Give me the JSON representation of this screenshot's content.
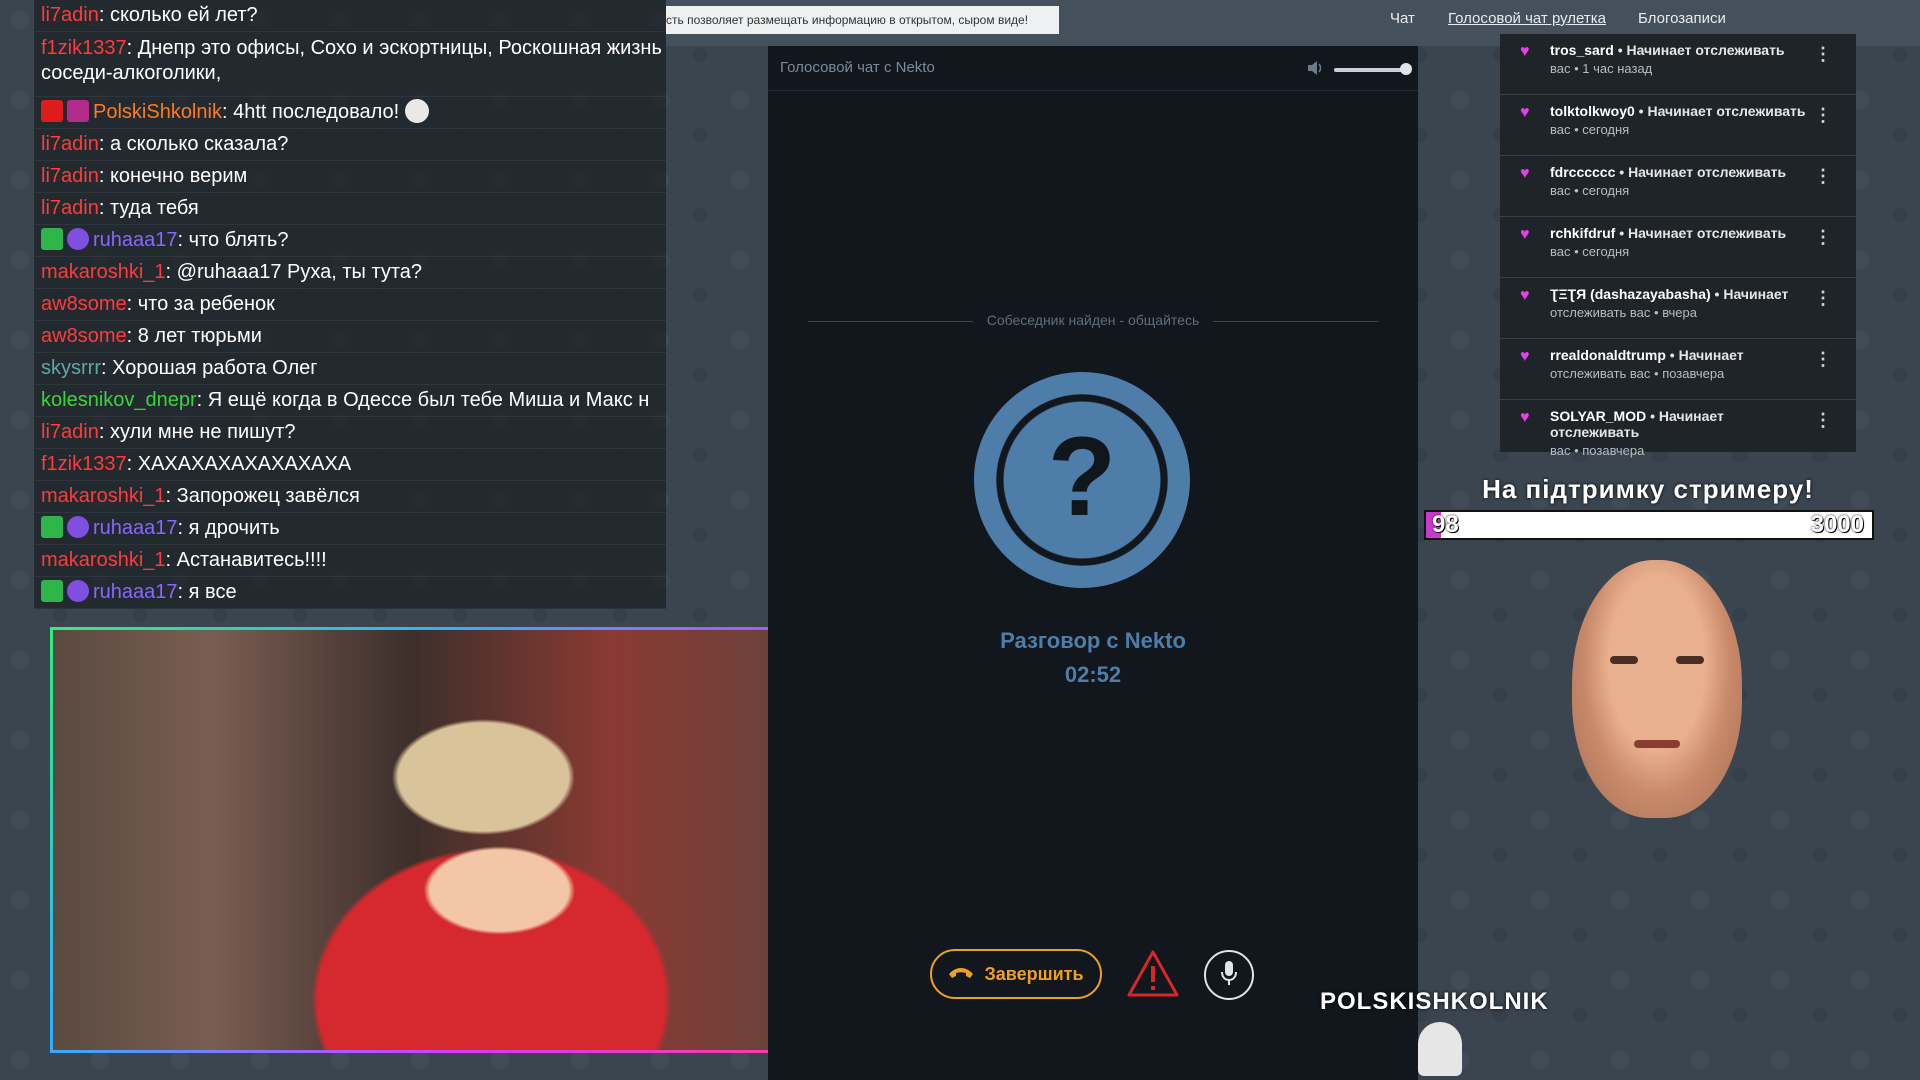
{
  "nav": {
    "notice": "сть позволяет размещать информацию в открытом, сыром виде!",
    "links": [
      "Чат",
      "Голосовой чат рулетка",
      "Блогозаписи"
    ]
  },
  "chat": [
    {
      "user": "li7adin",
      "color": "#ff3b3b",
      "text": "сколько ей лет?"
    },
    {
      "user": "f1zik1337",
      "color": "#ff3b3b",
      "text": "Днепр это офисы, Сохо и эскортницы, Роскошная жизнь соседи-алкоголики,",
      "tall": true
    },
    {
      "user": "PolskiShkolnik",
      "color": "#ff7a1a",
      "text": "4htt последовало!",
      "badges": [
        "red",
        "gift"
      ],
      "emote": true
    },
    {
      "user": "li7adin",
      "color": "#ff3b3b",
      "text": "а сколько сказала?"
    },
    {
      "user": "li7adin",
      "color": "#ff3b3b",
      "text": "конечно верим"
    },
    {
      "user": "li7adin",
      "color": "#ff3b3b",
      "text": "туда тебя"
    },
    {
      "user": "ruhaaa17",
      "color": "#8a66ff",
      "text": "что блять?",
      "badges": [
        "green",
        "purple"
      ]
    },
    {
      "user": "makaroshki_1",
      "color": "#ff3b3b",
      "text": "@ruhaaa17 Руха, ты тута?"
    },
    {
      "user": "aw8some",
      "color": "#ff3b3b",
      "text": "что за ребенок"
    },
    {
      "user": "aw8some",
      "color": "#ff3b3b",
      "text": "8 лет тюрьми"
    },
    {
      "user": "skysrrr",
      "color": "#5fa7a7",
      "text": "Хорошая работа Олег"
    },
    {
      "user": "kolesnikov_dnepr",
      "color": "#36d63a",
      "text": "Я ещё когда в Одессе был тебе Миша и Макс н"
    },
    {
      "user": "li7adin",
      "color": "#ff3b3b",
      "text": "хули мне не пишут?"
    },
    {
      "user": "f1zik1337",
      "color": "#ff3b3b",
      "text": "ХАХАХАХАХАХАХАХА"
    },
    {
      "user": "makaroshki_1",
      "color": "#ff3b3b",
      "text": "Запорожец завёлся"
    },
    {
      "user": "ruhaaa17",
      "color": "#8a66ff",
      "text": "я дрочить",
      "badges": [
        "green",
        "purple"
      ]
    },
    {
      "user": "makaroshki_1",
      "color": "#ff3b3b",
      "text": "Астанавитесь!!!!"
    },
    {
      "user": "ruhaaa17",
      "color": "#8a66ff",
      "text": "я все",
      "badges": [
        "green",
        "purple"
      ]
    }
  ],
  "voice": {
    "title": "Голосовой чат с Nekto",
    "status": "Собеседник найден - общайтесь",
    "conversation": "Разговор с Nekto",
    "timer": "02:52",
    "end_label": "Завершить"
  },
  "follows": [
    {
      "name": "tros_sard",
      "line1_rest": " • Начинает отслеживать",
      "line2": "вас • 1 час назад"
    },
    {
      "name": "tolktolkwoy0",
      "line1_rest": " • Начинает отслеживать",
      "line2": "вас • сегодня"
    },
    {
      "name": "fdrcccccc",
      "line1_rest": " • Начинает отслеживать",
      "line2": "вас • сегодня"
    },
    {
      "name": "rchkifdruf",
      "line1_rest": " • Начинает отслеживать",
      "line2": "вас • сегодня"
    },
    {
      "name": "ƮΞƮЯ (dashazayabasha)",
      "line1_rest": " • Начинает",
      "line2": "отслеживать вас • вчера"
    },
    {
      "name": "rrealdonaldtrump",
      "line1_rest": " • Начинает",
      "line2": "отслеживать вас • позавчера"
    },
    {
      "name": "SOLYAR_MOD",
      "line1_rest": " • Начинает отслеживать",
      "line2": "вас • позавчера"
    }
  ],
  "donation": {
    "title": "На підтримку стримеру!",
    "current": "98",
    "goal": "3000",
    "progress": 0.0327
  },
  "streamer_name": "POLSKISHKOLNIK",
  "colors": {
    "accent": "#4f7daa",
    "end": "#f0a020",
    "heart": "#e83ef0",
    "warn": "#d8262a"
  },
  "icons": {
    "volume": "volume-icon",
    "mic": "microphone-icon",
    "phone": "phone-hangup-icon",
    "warn": "warning-icon"
  }
}
